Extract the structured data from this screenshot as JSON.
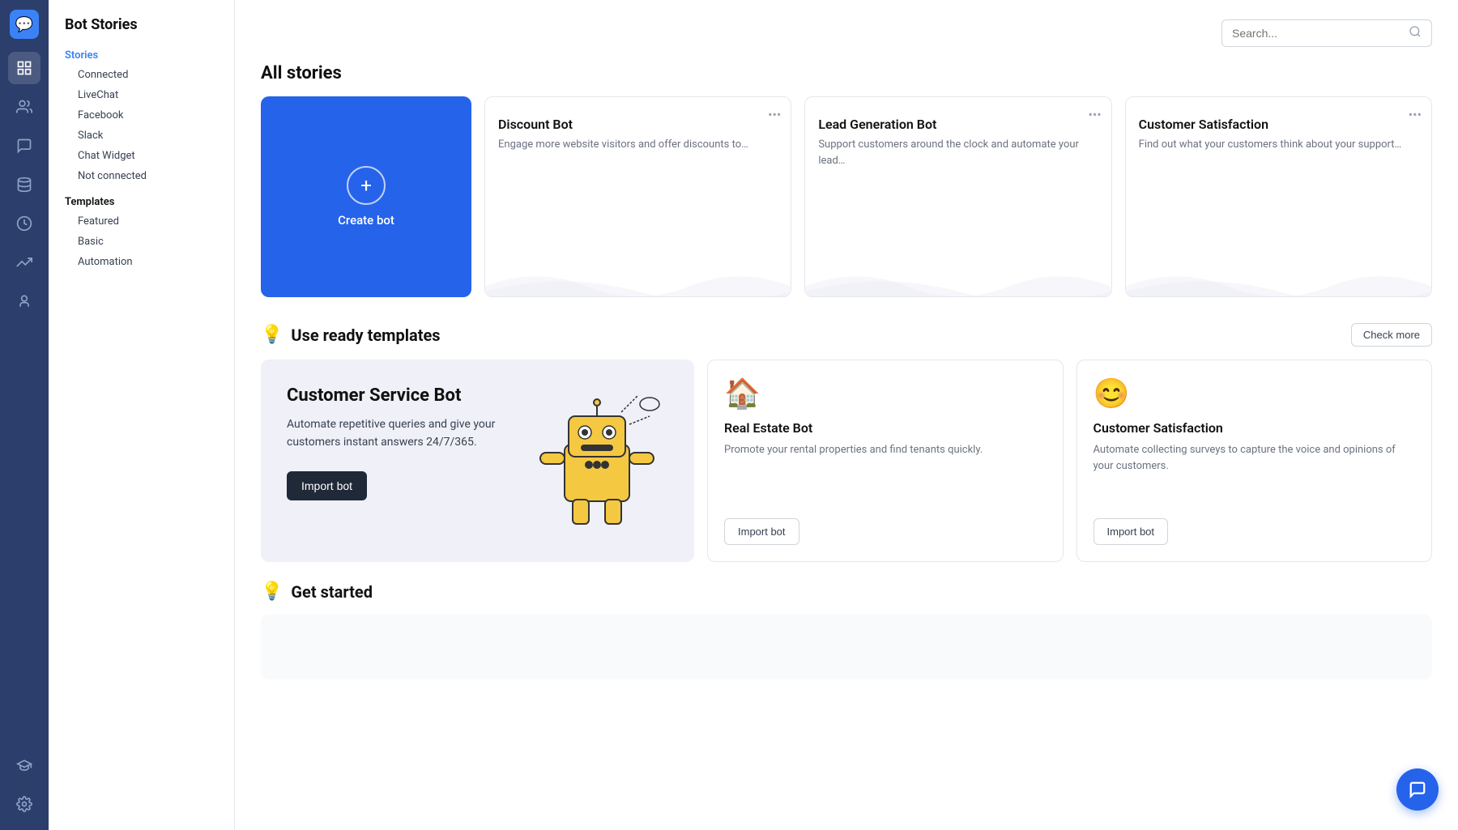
{
  "pageTitle": "Bot Stories",
  "search": {
    "placeholder": "Search..."
  },
  "sidebar": {
    "navItems": [
      {
        "id": "bots",
        "icon": "⚡",
        "active": true
      },
      {
        "id": "users",
        "icon": "👥",
        "active": false
      },
      {
        "id": "chat",
        "icon": "💬",
        "active": false
      },
      {
        "id": "database",
        "icon": "🗄",
        "active": false
      },
      {
        "id": "analytics",
        "icon": "🕐",
        "active": false
      },
      {
        "id": "reports",
        "icon": "📈",
        "active": false
      },
      {
        "id": "team",
        "icon": "👤",
        "active": false
      }
    ],
    "bottomItems": [
      {
        "id": "academy",
        "icon": "🎓"
      },
      {
        "id": "settings",
        "icon": "⚙"
      }
    ]
  },
  "leftNav": {
    "storiesLabel": "Stories",
    "connectedLabel": "Connected",
    "subItems": [
      {
        "label": "LiveChat"
      },
      {
        "label": "Facebook"
      },
      {
        "label": "Slack"
      },
      {
        "label": "Chat Widget"
      }
    ],
    "notConnectedLabel": "Not connected",
    "templatesLabel": "Templates",
    "templateSubItems": [
      {
        "label": "Featured"
      },
      {
        "label": "Basic"
      },
      {
        "label": "Automation"
      }
    ]
  },
  "allStories": {
    "title": "All stories",
    "createCard": {
      "label": "Create bot"
    },
    "botCards": [
      {
        "name": "Discount Bot",
        "description": "Engage more website visitors and offer discounts to…"
      },
      {
        "name": "Lead Generation Bot",
        "description": "Support customers around the clock and automate your lead…"
      },
      {
        "name": "Customer Satisfaction",
        "description": "Find out what your customers think about your support…"
      }
    ]
  },
  "templates": {
    "sectionTitle": "Use ready templates",
    "checkMoreLabel": "Check more",
    "mainCard": {
      "title": "Customer Service Bot",
      "description": "Automate repetitive queries and give your customers instant answers 24/7/365.",
      "importLabel": "Import bot"
    },
    "smallCards": [
      {
        "icon": "🏠",
        "name": "Real Estate Bot",
        "description": "Promote your rental properties and find tenants quickly.",
        "importLabel": "Import bot"
      },
      {
        "icon": "😊",
        "name": "Customer Satisfaction",
        "description": "Automate collecting surveys to capture the voice and opinions of your customers.",
        "importLabel": "Import bot"
      }
    ]
  },
  "getStarted": {
    "title": "Get started"
  },
  "floatingChat": {
    "icon": "💬"
  }
}
